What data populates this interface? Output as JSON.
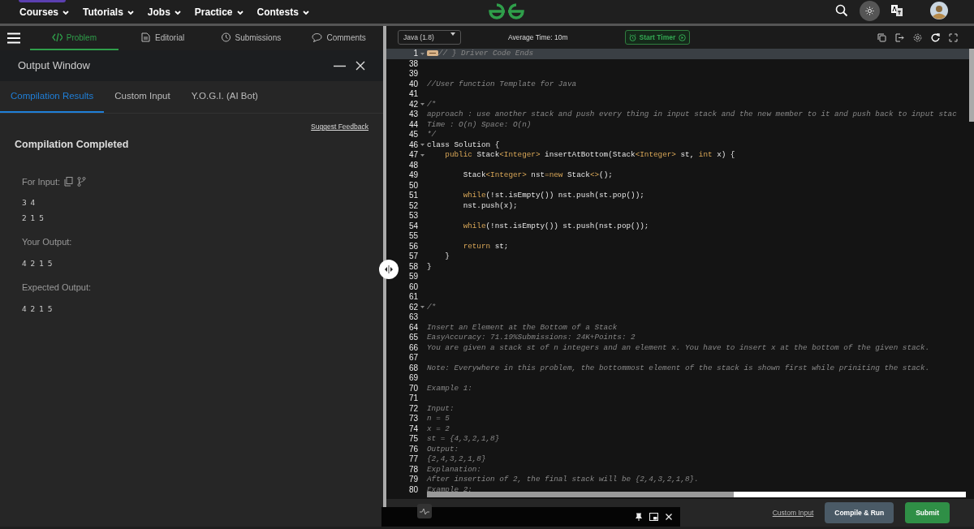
{
  "topnav": {
    "menus": [
      "Courses",
      "Tutorials",
      "Jobs",
      "Practice",
      "Contests"
    ]
  },
  "problem_tabs": [
    {
      "label": "Problem",
      "selected": true
    },
    {
      "label": "Editorial",
      "selected": false
    },
    {
      "label": "Submissions",
      "selected": false
    },
    {
      "label": "Comments",
      "selected": false
    }
  ],
  "output_window": {
    "title": "Output Window",
    "tabs": [
      {
        "label": "Compilation Results",
        "selected": true
      },
      {
        "label": "Custom Input",
        "selected": false
      },
      {
        "label": "Y.O.G.I. (AI Bot)",
        "selected": false
      }
    ],
    "feedback_link": "Suggest Feedback",
    "status": "Compilation Completed",
    "sections": [
      {
        "label": "For Input:",
        "icons": true,
        "lines": [
          "3 4",
          "2 1 5"
        ]
      },
      {
        "label": "Your Output:",
        "icons": false,
        "lines": [
          "4 2 1 5"
        ]
      },
      {
        "label": "Expected Output:",
        "icons": false,
        "lines": [
          "4 2 1 5"
        ]
      }
    ]
  },
  "editor": {
    "language": "Java (1.8)",
    "average_time": "Average Time: 10m",
    "timer_button": "Start Timer",
    "lines": [
      {
        "n": "1",
        "fold": true,
        "highlight": true,
        "tokens": [
          {
            "kind": "comment",
            "text": "// } Driver Code Ends"
          }
        ]
      },
      {
        "n": "38",
        "fold": false,
        "highlight": false
      },
      {
        "n": "39",
        "fold": false,
        "highlight": false
      },
      {
        "n": "40",
        "fold": false,
        "highlight": false,
        "tokens": [
          {
            "kind": "comment",
            "text": "//User function Template for Java"
          }
        ]
      },
      {
        "n": "41",
        "fold": false,
        "highlight": false
      },
      {
        "n": "42",
        "fold": true,
        "highlight": false,
        "tokens": [
          {
            "kind": "comment",
            "text": "/*"
          }
        ]
      },
      {
        "n": "43",
        "fold": false,
        "highlight": false,
        "tokens": [
          {
            "kind": "comment",
            "text": "approach : use another stack and push every thing in input stack and the new member to it and push back to input stac"
          }
        ]
      },
      {
        "n": "44",
        "fold": false,
        "highlight": false,
        "tokens": [
          {
            "kind": "comment",
            "text": "Time : O(n) Space: O(n)"
          }
        ]
      },
      {
        "n": "45",
        "fold": false,
        "highlight": false,
        "tokens": [
          {
            "kind": "comment",
            "text": "*/"
          }
        ]
      },
      {
        "n": "46",
        "fold": true,
        "highlight": false,
        "tokens": [
          {
            "kind": "plain",
            "text": "class Solution {"
          }
        ]
      },
      {
        "n": "47",
        "fold": true,
        "highlight": false,
        "tokens": [
          {
            "kind": "keyword",
            "text": "    public "
          },
          {
            "kind": "plain",
            "text": "Stack"
          },
          {
            "kind": "type",
            "text": "<Integer>"
          },
          {
            "kind": "plain",
            "text": " insertAtBottom(Stack"
          },
          {
            "kind": "type",
            "text": "<Integer>"
          },
          {
            "kind": "plain",
            "text": " st, "
          },
          {
            "kind": "keyword",
            "text": "int"
          },
          {
            "kind": "plain",
            "text": " x) {"
          }
        ]
      },
      {
        "n": "48",
        "fold": false,
        "highlight": false
      },
      {
        "n": "49",
        "fold": false,
        "highlight": false,
        "tokens": [
          {
            "kind": "plain",
            "text": "        Stack"
          },
          {
            "kind": "type",
            "text": "<Integer>"
          },
          {
            "kind": "plain",
            "text": " nst"
          },
          {
            "kind": "keyword",
            "text": "=new"
          },
          {
            "kind": "plain",
            "text": " Stack"
          },
          {
            "kind": "type",
            "text": "<>"
          },
          {
            "kind": "plain",
            "text": "();"
          }
        ]
      },
      {
        "n": "50",
        "fold": false,
        "highlight": false
      },
      {
        "n": "51",
        "fold": false,
        "highlight": false,
        "tokens": [
          {
            "kind": "keyword",
            "text": "        while"
          },
          {
            "kind": "plain",
            "text": "(!st.isEmpty()) nst.push(st.pop());"
          }
        ]
      },
      {
        "n": "52",
        "fold": false,
        "highlight": false,
        "tokens": [
          {
            "kind": "plain",
            "text": "        nst.push(x);"
          }
        ]
      },
      {
        "n": "53",
        "fold": false,
        "highlight": false
      },
      {
        "n": "54",
        "fold": false,
        "highlight": false,
        "tokens": [
          {
            "kind": "keyword",
            "text": "        while"
          },
          {
            "kind": "plain",
            "text": "(!nst.isEmpty()) st.push(nst.pop());"
          }
        ]
      },
      {
        "n": "55",
        "fold": false,
        "highlight": false
      },
      {
        "n": "56",
        "fold": false,
        "highlight": false,
        "tokens": [
          {
            "kind": "keyword",
            "text": "        return"
          },
          {
            "kind": "plain",
            "text": " st;"
          }
        ]
      },
      {
        "n": "57",
        "fold": false,
        "highlight": false,
        "tokens": [
          {
            "kind": "plain",
            "text": "    }"
          }
        ]
      },
      {
        "n": "58",
        "fold": false,
        "highlight": false,
        "tokens": [
          {
            "kind": "plain",
            "text": "}"
          }
        ]
      },
      {
        "n": "59",
        "fold": false,
        "highlight": false
      },
      {
        "n": "60",
        "fold": false,
        "highlight": false
      },
      {
        "n": "61",
        "fold": false,
        "highlight": false
      },
      {
        "n": "62",
        "fold": true,
        "highlight": false,
        "tokens": [
          {
            "kind": "comment",
            "text": "/*"
          }
        ]
      },
      {
        "n": "63",
        "fold": false,
        "highlight": false
      },
      {
        "n": "64",
        "fold": false,
        "highlight": false,
        "tokens": [
          {
            "kind": "comment",
            "text": "Insert an Element at the Bottom of a Stack"
          }
        ]
      },
      {
        "n": "65",
        "fold": false,
        "highlight": false,
        "tokens": [
          {
            "kind": "comment",
            "text": "EasyAccuracy: 71.19%Submissions: 24K+Points: 2"
          }
        ]
      },
      {
        "n": "66",
        "fold": false,
        "highlight": false,
        "tokens": [
          {
            "kind": "comment",
            "text": "You are given a stack st of n integers and an element x. You have to insert x at the bottom of the given stack."
          }
        ]
      },
      {
        "n": "67",
        "fold": false,
        "highlight": false
      },
      {
        "n": "68",
        "fold": false,
        "highlight": false,
        "tokens": [
          {
            "kind": "comment",
            "text": "Note: Everywhere in this problem, the bottommost element of the stack is shown first while priniting the stack."
          }
        ]
      },
      {
        "n": "69",
        "fold": false,
        "highlight": false
      },
      {
        "n": "70",
        "fold": false,
        "highlight": false,
        "tokens": [
          {
            "kind": "comment",
            "text": "Example 1:"
          }
        ]
      },
      {
        "n": "71",
        "fold": false,
        "highlight": false
      },
      {
        "n": "72",
        "fold": false,
        "highlight": false,
        "tokens": [
          {
            "kind": "comment",
            "text": "Input:"
          }
        ]
      },
      {
        "n": "73",
        "fold": false,
        "highlight": false,
        "tokens": [
          {
            "kind": "comment",
            "text": "n = 5"
          }
        ]
      },
      {
        "n": "74",
        "fold": false,
        "highlight": false,
        "tokens": [
          {
            "kind": "comment",
            "text": "x = 2"
          }
        ]
      },
      {
        "n": "75",
        "fold": false,
        "highlight": false,
        "tokens": [
          {
            "kind": "comment",
            "text": "st = {4,3,2,1,8}"
          }
        ]
      },
      {
        "n": "76",
        "fold": false,
        "highlight": false,
        "tokens": [
          {
            "kind": "comment",
            "text": "Output:"
          }
        ]
      },
      {
        "n": "77",
        "fold": false,
        "highlight": false,
        "tokens": [
          {
            "kind": "comment",
            "text": "{2,4,3,2,1,8}"
          }
        ]
      },
      {
        "n": "78",
        "fold": false,
        "highlight": false,
        "tokens": [
          {
            "kind": "comment",
            "text": "Explanation:"
          }
        ]
      },
      {
        "n": "79",
        "fold": false,
        "highlight": false,
        "tokens": [
          {
            "kind": "comment",
            "text": "After insertion of 2, the final stack will be {2,4,3,2,1,8}."
          }
        ]
      },
      {
        "n": "80",
        "fold": false,
        "highlight": false,
        "tokens": [
          {
            "kind": "comment",
            "text": "Example 2:"
          }
        ]
      }
    ]
  },
  "footer": {
    "custom_input": "Custom Input",
    "compile_button": "Compile & Run",
    "submit_button": "Submit"
  }
}
